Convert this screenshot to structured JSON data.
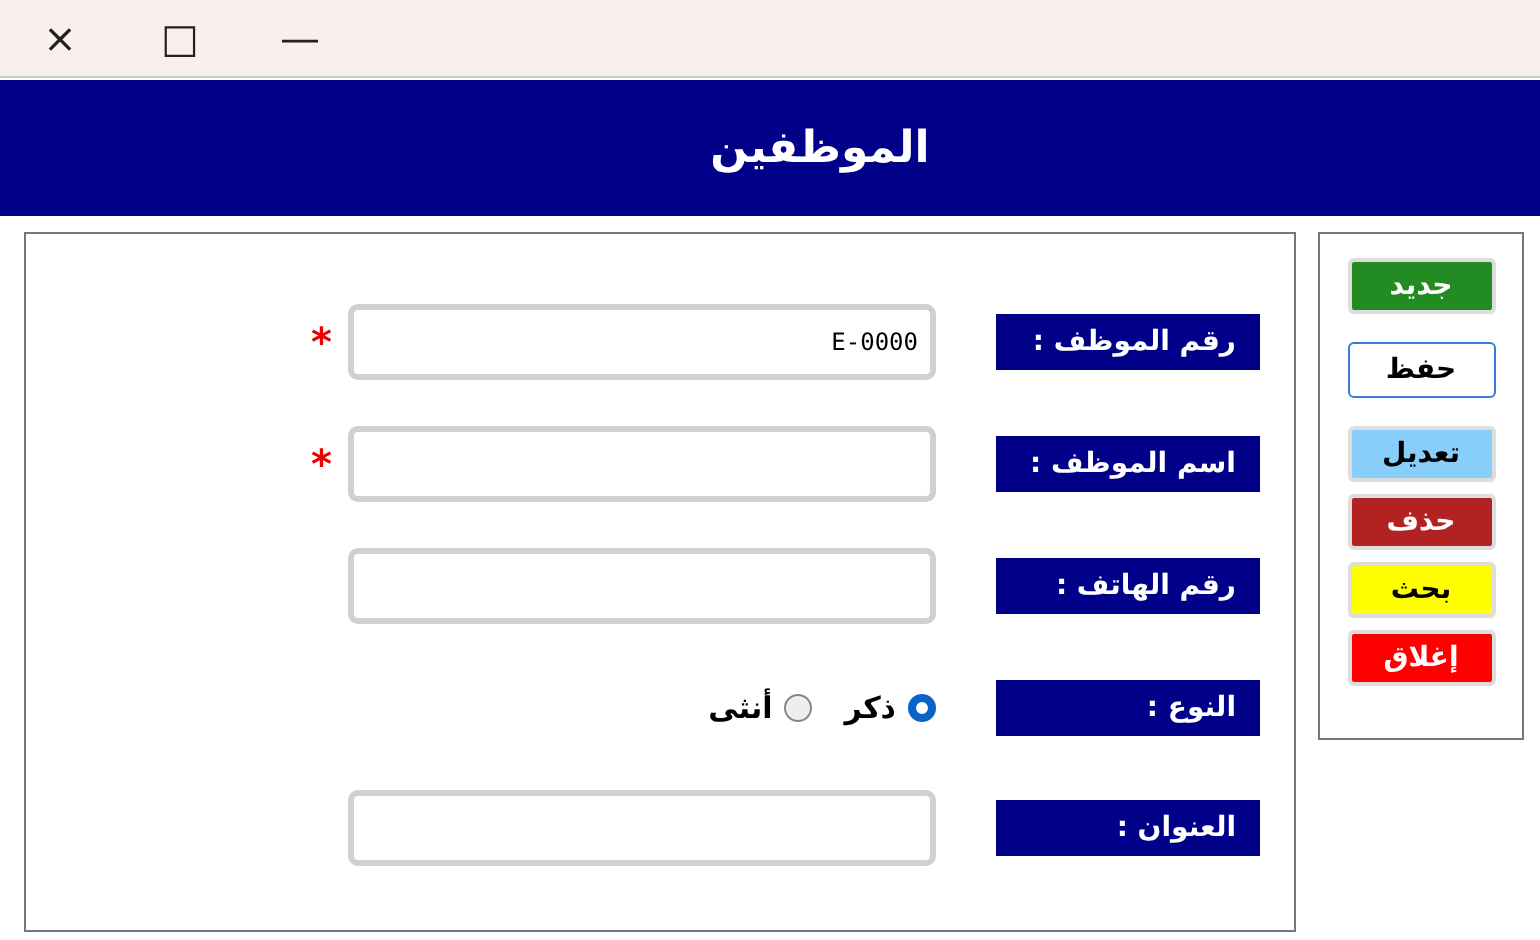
{
  "window": {
    "controls": [
      "—",
      "□",
      "×"
    ]
  },
  "header": {
    "title": "الموظفين"
  },
  "fields": [
    {
      "kind": "text",
      "label": "رقم الموظف :",
      "value": "E-0000",
      "required": true
    },
    {
      "kind": "text",
      "label": "اسم الموظف :",
      "required": true
    },
    {
      "kind": "text",
      "label": "رقم الهاتف :",
      "required": false
    },
    {
      "kind": "radio",
      "label": "النوع :",
      "options": [
        {
          "label": "ذكر",
          "selected": true
        },
        {
          "label": "أنثى",
          "selected": false
        }
      ]
    },
    {
      "kind": "text",
      "label": "العنوان :",
      "required": false
    }
  ],
  "required_mark": "*",
  "buttons": [
    {
      "label": "جديد",
      "kind": "filled",
      "color": "#228b22"
    },
    {
      "label": "حفظ",
      "kind": "focused"
    },
    {
      "label": "تعديل",
      "kind": "filled",
      "color": "#87cefa"
    },
    {
      "label": "حذف",
      "kind": "filled",
      "color": "#b22222"
    },
    {
      "label": "بحث",
      "kind": "filled",
      "color": "#ffff00"
    },
    {
      "label": "إغلاق",
      "kind": "filled",
      "color": "#ff0000"
    }
  ]
}
